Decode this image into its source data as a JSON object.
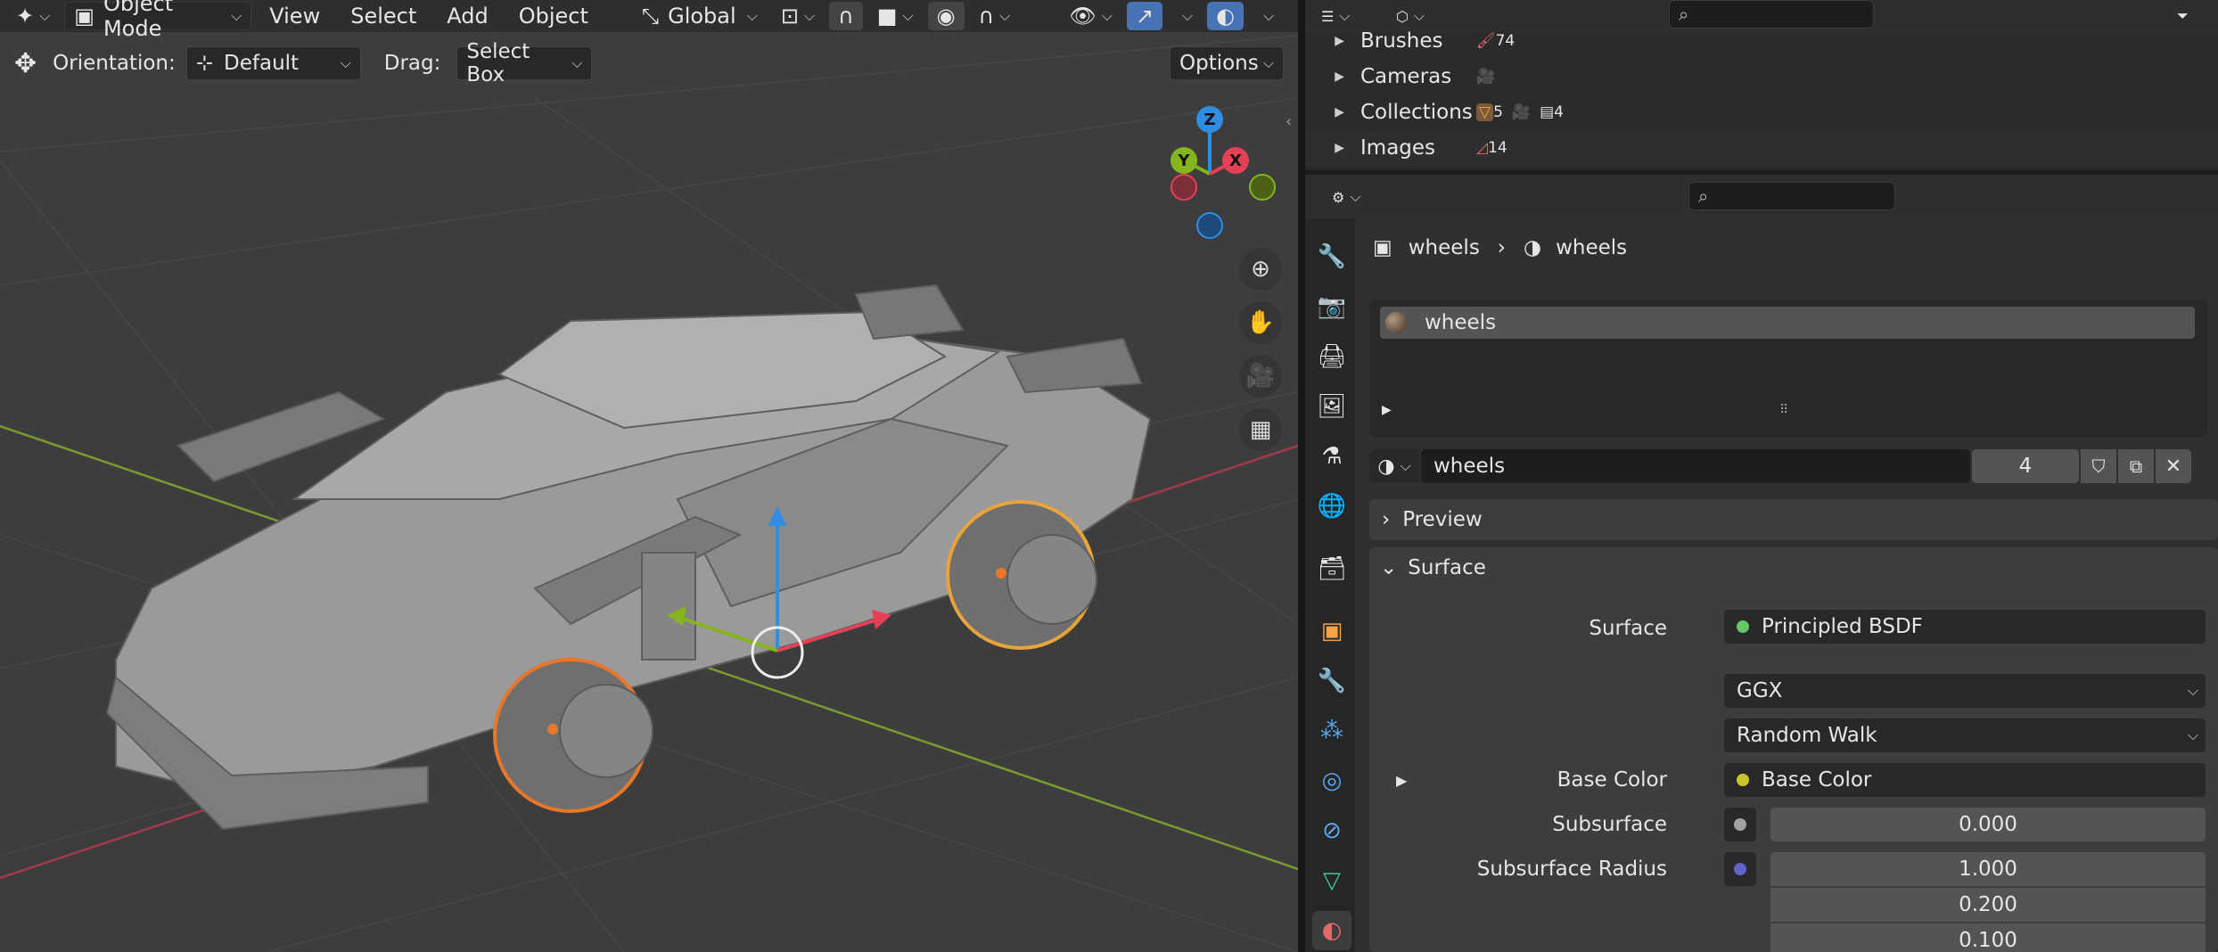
{
  "viewport_header": {
    "mode": "Object Mode",
    "menus": [
      "View",
      "Select",
      "Add",
      "Object"
    ],
    "transform_orientation": "Global"
  },
  "tool_settings": {
    "orientation_label": "Orientation:",
    "orientation_value": "Default",
    "drag_label": "Drag:",
    "drag_value": "Select Box",
    "options_label": "Options"
  },
  "gizmo": {
    "z": "Z",
    "y": "Y",
    "x": "X"
  },
  "outliner": {
    "rows": [
      {
        "label": "Brushes",
        "count": "74"
      },
      {
        "label": "Cameras",
        "count": ""
      },
      {
        "label": "Collections",
        "count": "5",
        "count2": "4"
      },
      {
        "label": "Images",
        "count": "14"
      }
    ]
  },
  "properties": {
    "breadcrumb_object": "wheels",
    "breadcrumb_material": "wheels",
    "material_slot": "wheels",
    "material_name": "wheels",
    "users": "4",
    "panels": {
      "preview": "Preview",
      "surface": "Surface"
    },
    "surface_label": "Surface",
    "surface_value": "Principled BSDF",
    "distribution": "GGX",
    "subsurface_method": "Random Walk",
    "base_color_label": "Base Color",
    "base_color_value": "Base Color",
    "subsurface_label": "Subsurface",
    "subsurface_value": "0.000",
    "subsurface_radius_label": "Subsurface Radius",
    "subsurface_radius": [
      "1.000",
      "0.200",
      "0.100"
    ]
  },
  "colors": {
    "accent": "#4772b3",
    "selection": "#e8762b",
    "viewport_bg": "#3d3d3d",
    "x_axis": "#e64057",
    "y_axis": "#86b41c",
    "z_axis": "#2f8ee2"
  }
}
